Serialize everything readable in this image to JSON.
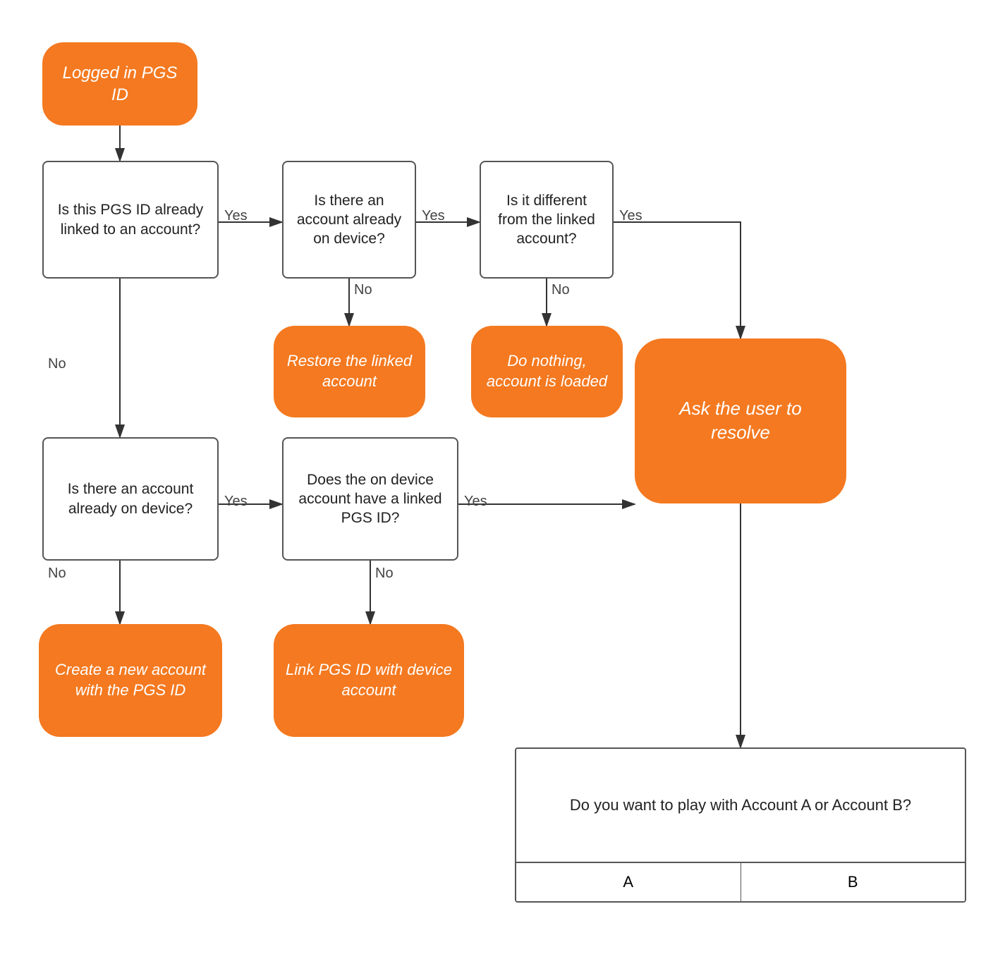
{
  "nodes": {
    "start": {
      "label": "Logged in PGS ID"
    },
    "q1": {
      "label": "Is this PGS ID already linked to an account?"
    },
    "q2": {
      "label": "Is there an account already on device?"
    },
    "q3": {
      "label": "Is it different from the linked account?"
    },
    "q4": {
      "label": "Is there an account already on device?"
    },
    "q5": {
      "label": "Does the on device account have a linked PGS ID?"
    },
    "r1": {
      "label": "Restore the linked account"
    },
    "r2": {
      "label": "Do nothing, account is loaded"
    },
    "r3": {
      "label": "Ask the user to resolve"
    },
    "r4": {
      "label": "Create a new account with the PGS ID"
    },
    "r5": {
      "label": "Link PGS ID with device account"
    },
    "dialog_text": {
      "label": "Do you want to play with Account A or Account B?"
    },
    "btn_a": {
      "label": "A"
    },
    "btn_b": {
      "label": "B"
    }
  },
  "labels": {
    "yes1": "Yes",
    "yes2": "Yes",
    "yes3": "Yes",
    "yes4": "Yes",
    "no1": "No",
    "no2": "No",
    "no3": "No",
    "no4": "No"
  },
  "colors": {
    "orange": "#F47920",
    "border": "#555",
    "text": "#222",
    "arrow": "#333"
  }
}
